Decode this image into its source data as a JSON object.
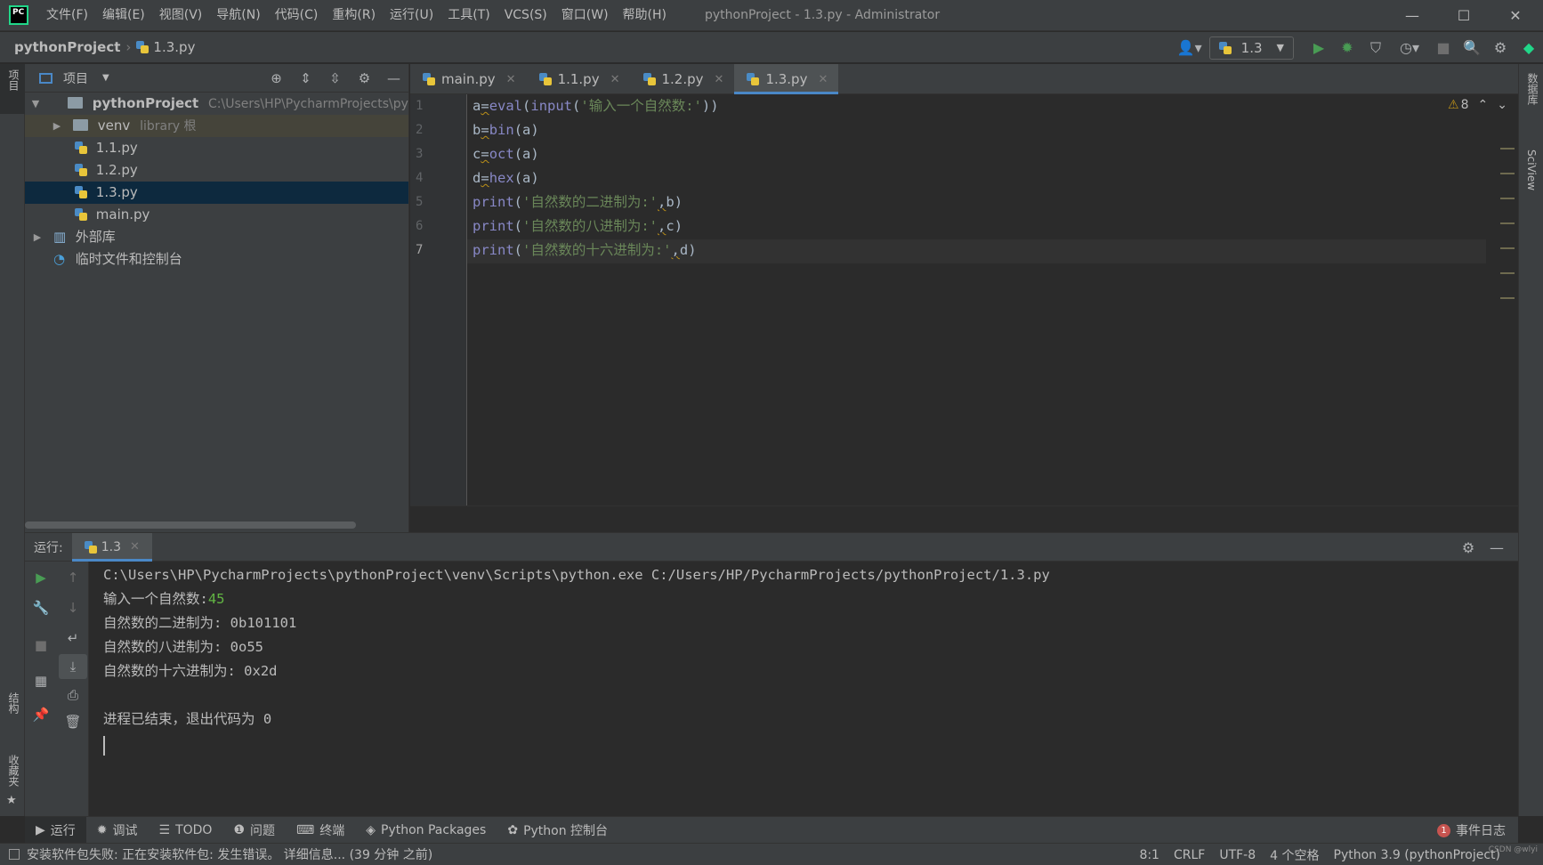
{
  "menu": [
    "文件(F)",
    "编辑(E)",
    "视图(V)",
    "导航(N)",
    "代码(C)",
    "重构(R)",
    "运行(U)",
    "工具(T)",
    "VCS(S)",
    "窗口(W)",
    "帮助(H)"
  ],
  "window": {
    "title": "pythonProject - 1.3.py - Administrator",
    "logo": "PC"
  },
  "breadcrumb": {
    "project": "pythonProject",
    "file": "1.3.py"
  },
  "run_config": {
    "name": "1.3"
  },
  "project_panel": {
    "title": "项目",
    "root": {
      "name": "pythonProject",
      "path": "C:\\Users\\HP\\PycharmProjects\\pythonProject"
    },
    "venv": {
      "name": "venv",
      "hint": "library 根"
    },
    "files": [
      "1.1.py",
      "1.2.py",
      "1.3.py",
      "main.py"
    ],
    "external_libs": "外部库",
    "scratches": "临时文件和控制台"
  },
  "editor_tabs": [
    "main.py",
    "1.1.py",
    "1.2.py",
    "1.3.py"
  ],
  "active_tab": "1.3.py",
  "code": {
    "line_numbers": [
      "1",
      "2",
      "3",
      "4",
      "5",
      "6",
      "7"
    ],
    "l1": {
      "a": "a",
      "eq": "=",
      "f1": "eval",
      "p1": "(",
      "f2": "input",
      "p2": "(",
      "s": "'输入一个自然数:'",
      "p3": "))"
    },
    "l2": {
      "v": "b",
      "eq": "=",
      "f": "bin",
      "args": "(a)"
    },
    "l3": {
      "v": "c",
      "eq": "=",
      "f": "oct",
      "args": "(a)"
    },
    "l4": {
      "v": "d",
      "eq": "=",
      "f": "hex",
      "args": "(a)"
    },
    "l5": {
      "f": "print",
      "p": "(",
      "s": "'自然数的二进制为:'",
      "c": ",",
      "rest": "b)"
    },
    "l6": {
      "f": "print",
      "p": "(",
      "s": "'自然数的八进制为:'",
      "c": ",",
      "rest": "c)"
    },
    "l7": {
      "f": "print",
      "p": "(",
      "s": "'自然数的十六进制为:'",
      "c": ",",
      "rest": "d)"
    }
  },
  "inspection": {
    "warnings": "8"
  },
  "run_panel": {
    "label": "运行:",
    "tab": "1.3",
    "console": {
      "command": "C:\\Users\\HP\\PycharmProjects\\pythonProject\\venv\\Scripts\\python.exe C:/Users/HP/PycharmProjects/pythonProject/1.3.py",
      "prompt": "输入一个自然数:",
      "input": "45",
      "out_bin": "自然数的二进制为: 0b101101",
      "out_oct": "自然数的八进制为: 0o55",
      "out_hex": "自然数的十六进制为: 0x2d",
      "exit": "进程已结束，退出代码为 0"
    }
  },
  "tool_windows": [
    "运行",
    "调试",
    "TODO",
    "问题",
    "终端",
    "Python Packages",
    "Python 控制台"
  ],
  "event_log": {
    "count": "1",
    "label": "事件日志"
  },
  "left_strip": {
    "project": "项目",
    "structure": "结构",
    "favorites": "收藏夹"
  },
  "right_strip": {
    "database": "数据库",
    "sciview": "SciView"
  },
  "status": {
    "message": "安装软件包失败: 正在安装软件包: 发生错误。 详细信息... (39 分钟 之前)",
    "position": "8:1",
    "line_sep": "CRLF",
    "encoding": "UTF-8",
    "indent": "4 个空格",
    "interpreter": "Python 3.9 (pythonProject)",
    "watermark": "CSDN @wlyi"
  }
}
